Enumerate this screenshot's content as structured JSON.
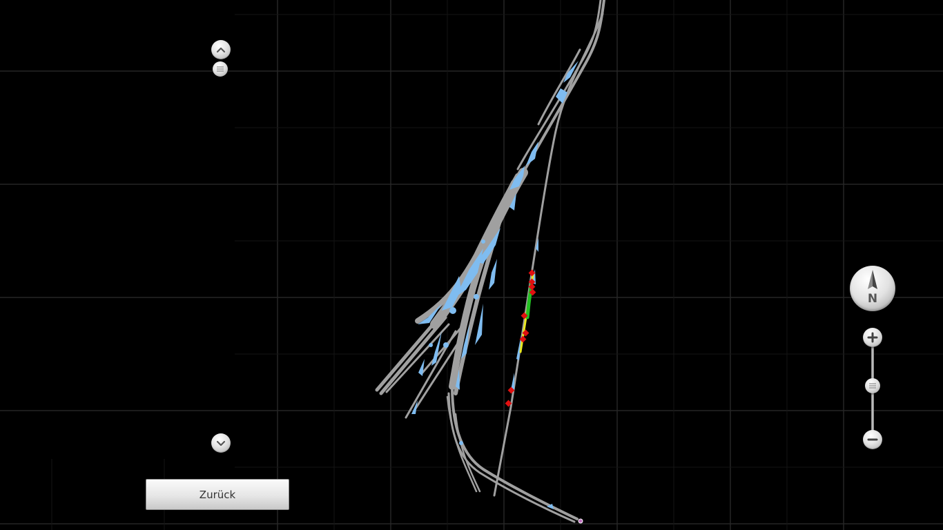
{
  "back_button": {
    "label": "Zurück"
  },
  "compass": {
    "label": "N"
  },
  "zoom": {
    "level": 0.55
  },
  "icons": {
    "scroll_up": "chevron-up-icon",
    "scroll_down": "chevron-down-icon",
    "zoom_in": "plus-icon",
    "zoom_out": "minus-icon",
    "compass": "compass-needle-icon"
  },
  "colors": {
    "background": "#000000",
    "track": "#a0a0a0",
    "highlight": "#7fbcf0",
    "route_green": "#22c022",
    "route_yellow": "#e8e820",
    "signal": "#e01010"
  }
}
